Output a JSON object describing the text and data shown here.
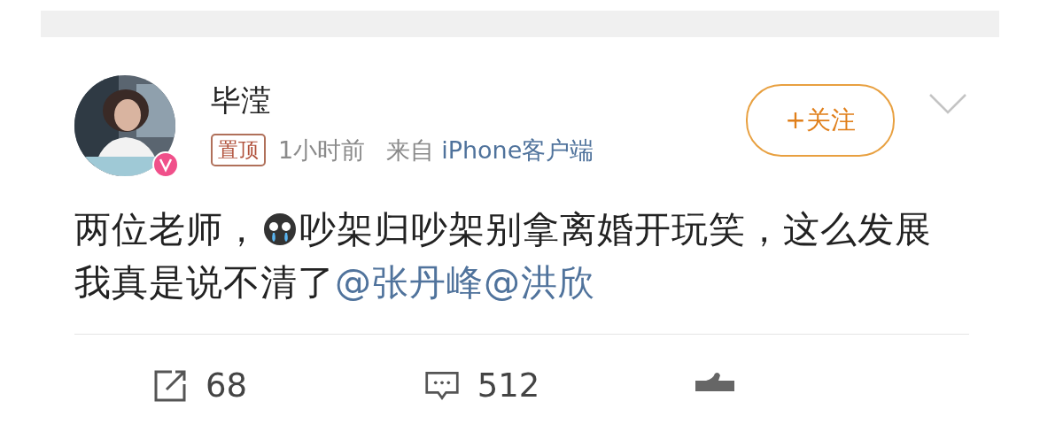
{
  "post": {
    "author": "毕滢",
    "pinned_label": "置顶",
    "time": "1小时前",
    "source_prefix": "来自",
    "source": "iPhone客户端",
    "follow_label": "+关注",
    "body_before": "两位老师，",
    "body_after": "吵架归吵架别拿离婚开玩笑，这么发展我真是说不清了",
    "mentions": [
      "@张丹峰",
      "@洪欣"
    ]
  },
  "actions": [
    {
      "kind": "repost",
      "count": "68"
    },
    {
      "kind": "comment",
      "count": "512"
    },
    {
      "kind": "like"
    }
  ]
}
